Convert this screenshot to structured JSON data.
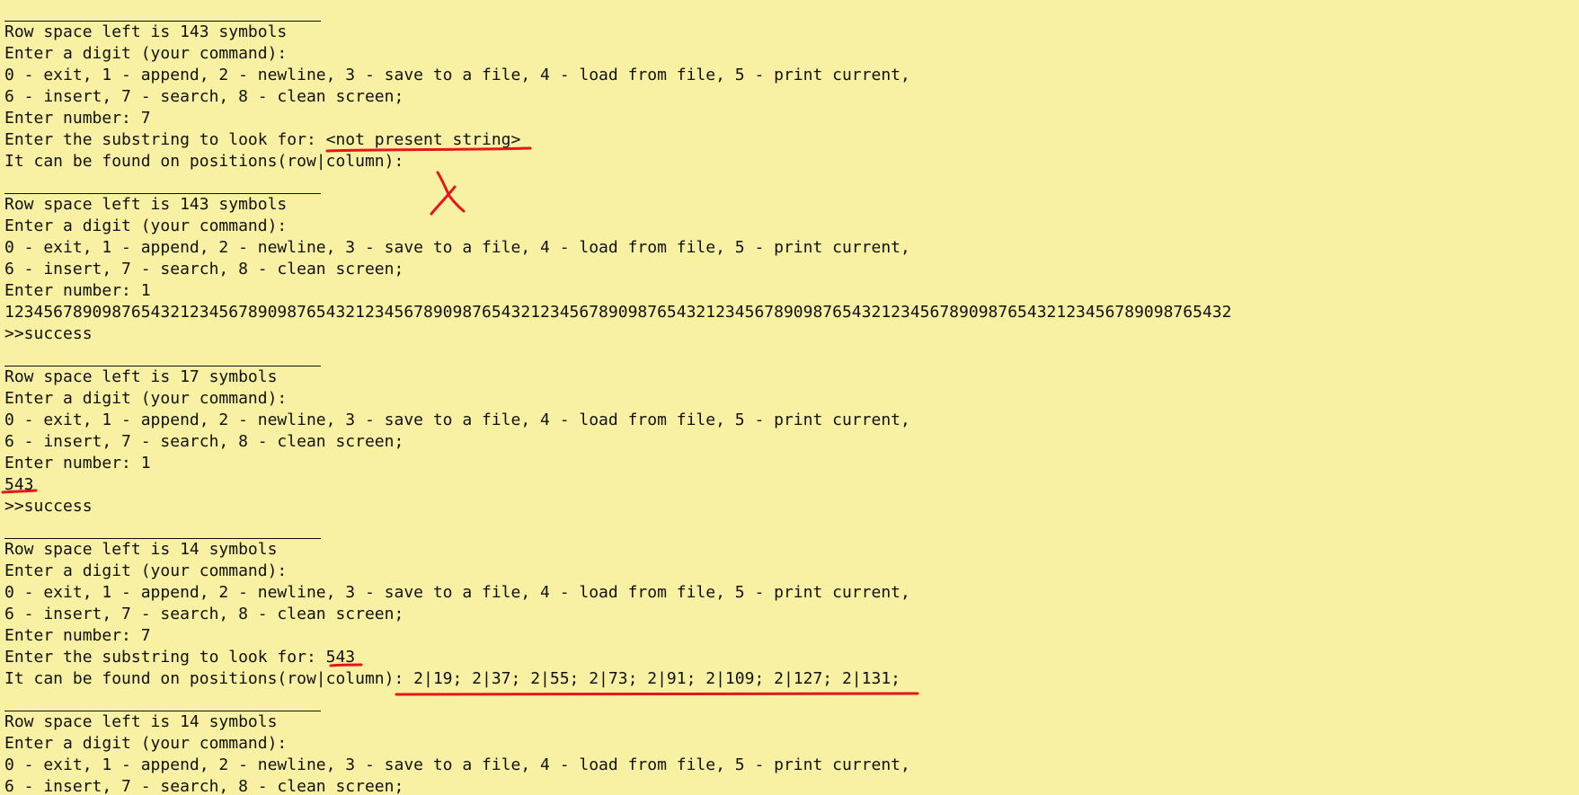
{
  "theme": {
    "background": "#f8f0a3",
    "text": "#111111",
    "annotation": "#e5161b"
  },
  "console": {
    "lines": [
      {
        "type": "separator"
      },
      {
        "type": "text",
        "text": "Row space left is 143 symbols"
      },
      {
        "type": "text",
        "text": "Enter a digit (your command):"
      },
      {
        "type": "text",
        "text": "0 - exit, 1 - append, 2 - newline, 3 - save to a file, 4 - load from file, 5 - print current,"
      },
      {
        "type": "text",
        "text": "6 - insert, 7 - search, 8 - clean screen;"
      },
      {
        "type": "text",
        "text": "Enter number: 7"
      },
      {
        "type": "text",
        "text": "Enter the substring to look for: <not present string>"
      },
      {
        "type": "text",
        "text": "It can be found on positions(row|column):"
      },
      {
        "type": "separator"
      },
      {
        "type": "text",
        "text": "Row space left is 143 symbols"
      },
      {
        "type": "text",
        "text": "Enter a digit (your command):"
      },
      {
        "type": "text",
        "text": "0 - exit, 1 - append, 2 - newline, 3 - save to a file, 4 - load from file, 5 - print current,"
      },
      {
        "type": "text",
        "text": "6 - insert, 7 - search, 8 - clean screen;"
      },
      {
        "type": "text",
        "text": "Enter number: 1"
      },
      {
        "type": "text",
        "text": "123456789098765432123456789098765432123456789098765432123456789098765432123456789098765432123456789098765432123456789098765432"
      },
      {
        "type": "text",
        "text": ">>success"
      },
      {
        "type": "separator"
      },
      {
        "type": "text",
        "text": "Row space left is 17 symbols"
      },
      {
        "type": "text",
        "text": "Enter a digit (your command):"
      },
      {
        "type": "text",
        "text": "0 - exit, 1 - append, 2 - newline, 3 - save to a file, 4 - load from file, 5 - print current,"
      },
      {
        "type": "text",
        "text": "6 - insert, 7 - search, 8 - clean screen;"
      },
      {
        "type": "text",
        "text": "Enter number: 1"
      },
      {
        "type": "text",
        "text": "543"
      },
      {
        "type": "text",
        "text": ">>success"
      },
      {
        "type": "separator"
      },
      {
        "type": "text",
        "text": "Row space left is 14 symbols"
      },
      {
        "type": "text",
        "text": "Enter a digit (your command):"
      },
      {
        "type": "text",
        "text": "0 - exit, 1 - append, 2 - newline, 3 - save to a file, 4 - load from file, 5 - print current,"
      },
      {
        "type": "text",
        "text": "6 - insert, 7 - search, 8 - clean screen;"
      },
      {
        "type": "text",
        "text": "Enter number: 7"
      },
      {
        "type": "text",
        "text": "Enter the substring to look for: 543"
      },
      {
        "type": "text",
        "text": "It can be found on positions(row|column): 2|19; 2|37; 2|55; 2|73; 2|91; 2|109; 2|127; 2|131;"
      },
      {
        "type": "separator"
      },
      {
        "type": "text",
        "text": "Row space left is 14 symbols"
      },
      {
        "type": "text",
        "text": "Enter a digit (your command):"
      },
      {
        "type": "text",
        "text": "0 - exit, 1 - append, 2 - newline, 3 - save to a file, 4 - load from file, 5 - print current,"
      },
      {
        "type": "text",
        "text": "6 - insert, 7 - search, 8 - clean screen;"
      }
    ]
  }
}
